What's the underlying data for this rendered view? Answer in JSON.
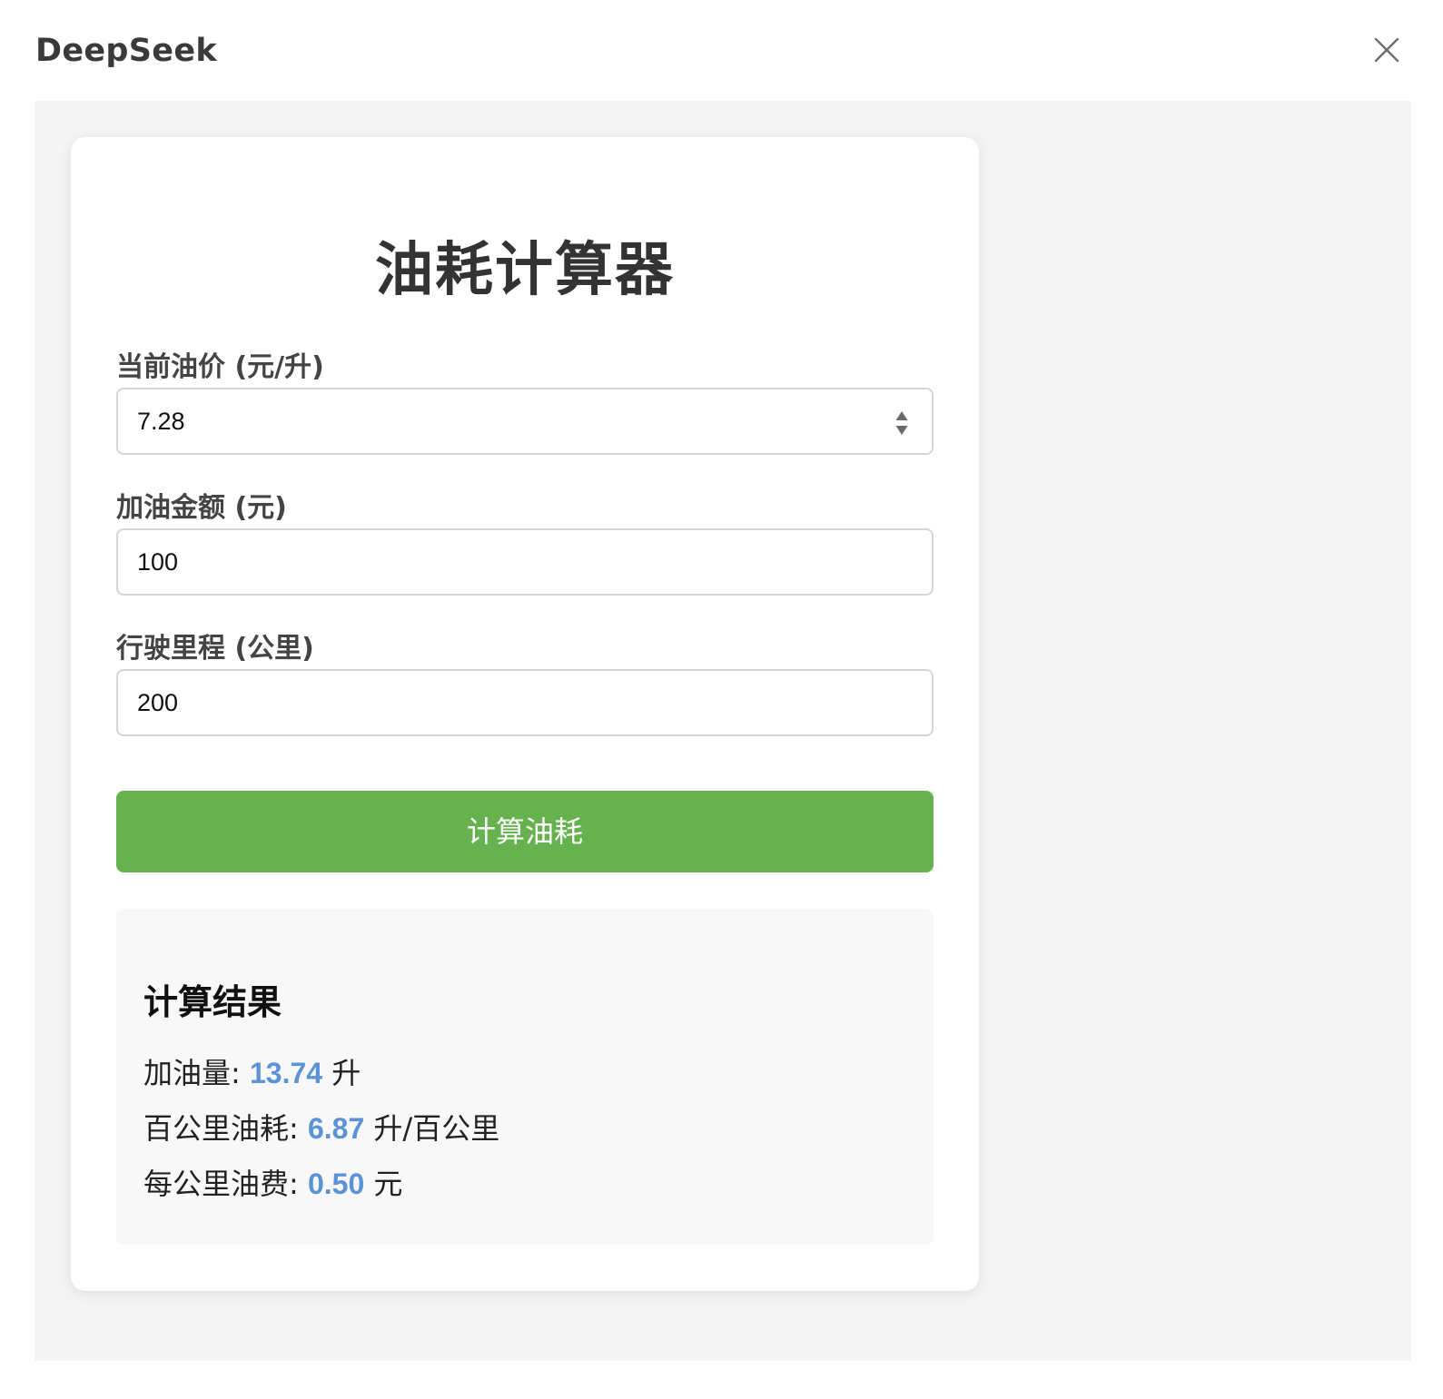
{
  "window": {
    "title": "DeepSeek"
  },
  "calculator": {
    "title": "油耗计算器",
    "fields": [
      {
        "label": "当前油价 (元/升)",
        "value": "7.28"
      },
      {
        "label": "加油金额 (元)",
        "value": "100"
      },
      {
        "label": "行驶里程 (公里)",
        "value": "200"
      }
    ],
    "button_label": "计算油耗",
    "result": {
      "title": "计算结果",
      "lines": [
        {
          "label": "加油量: ",
          "value": "13.74",
          "unit": " 升"
        },
        {
          "label": "百公里油耗: ",
          "value": "6.87",
          "unit": " 升/百公里"
        },
        {
          "label": "每公里油费: ",
          "value": "0.50",
          "unit": " 元"
        }
      ]
    }
  },
  "icons": {
    "close": "close-icon",
    "spinner": "spinner-arrows-icon"
  },
  "colors": {
    "button": "#66b24f",
    "result_value": "#5b93d6",
    "background": "#f4f4f4"
  }
}
